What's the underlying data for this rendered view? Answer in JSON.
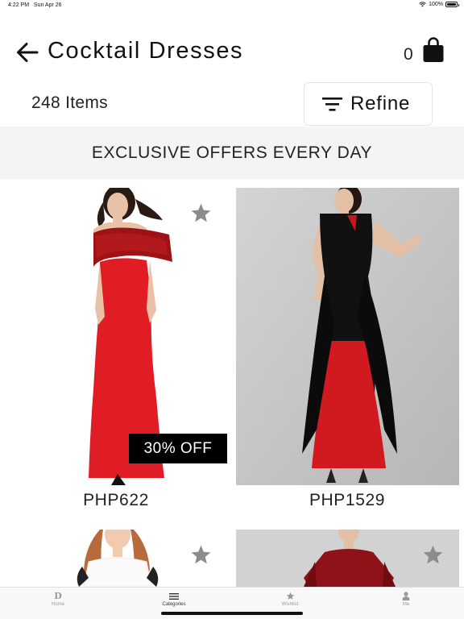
{
  "status_bar": {
    "time": "4:22 PM",
    "date": "Sun Apr 26",
    "battery": "100%",
    "battery_level": 1.0
  },
  "header": {
    "title": "Cocktail Dresses",
    "cart_count": "0"
  },
  "toolbar": {
    "items_count": "248 Items",
    "refine_label": "Refine"
  },
  "promo": {
    "text": "EXCLUSIVE OFFERS EVERY DAY"
  },
  "products": [
    {
      "price": "PHP622",
      "badge": "30% OFF",
      "wishlisted": false
    },
    {
      "price": "PHP1529",
      "badge": null,
      "wishlisted": false
    },
    {
      "price": "",
      "badge": null,
      "wishlisted": false
    },
    {
      "price": "",
      "badge": null,
      "wishlisted": false
    }
  ],
  "tabs": [
    {
      "label": "Home",
      "icon": "home-logo-icon",
      "active": false
    },
    {
      "label": "Categories",
      "icon": "list-icon",
      "active": true
    },
    {
      "label": "Wishlist",
      "icon": "star-icon",
      "active": false
    },
    {
      "label": "Me",
      "icon": "person-icon",
      "active": false
    }
  ],
  "colors": {
    "dress_red": "#e01d24",
    "badge_bg": "#000000",
    "star": "#8c8c8c",
    "banner_bg": "#f3f4f6"
  }
}
